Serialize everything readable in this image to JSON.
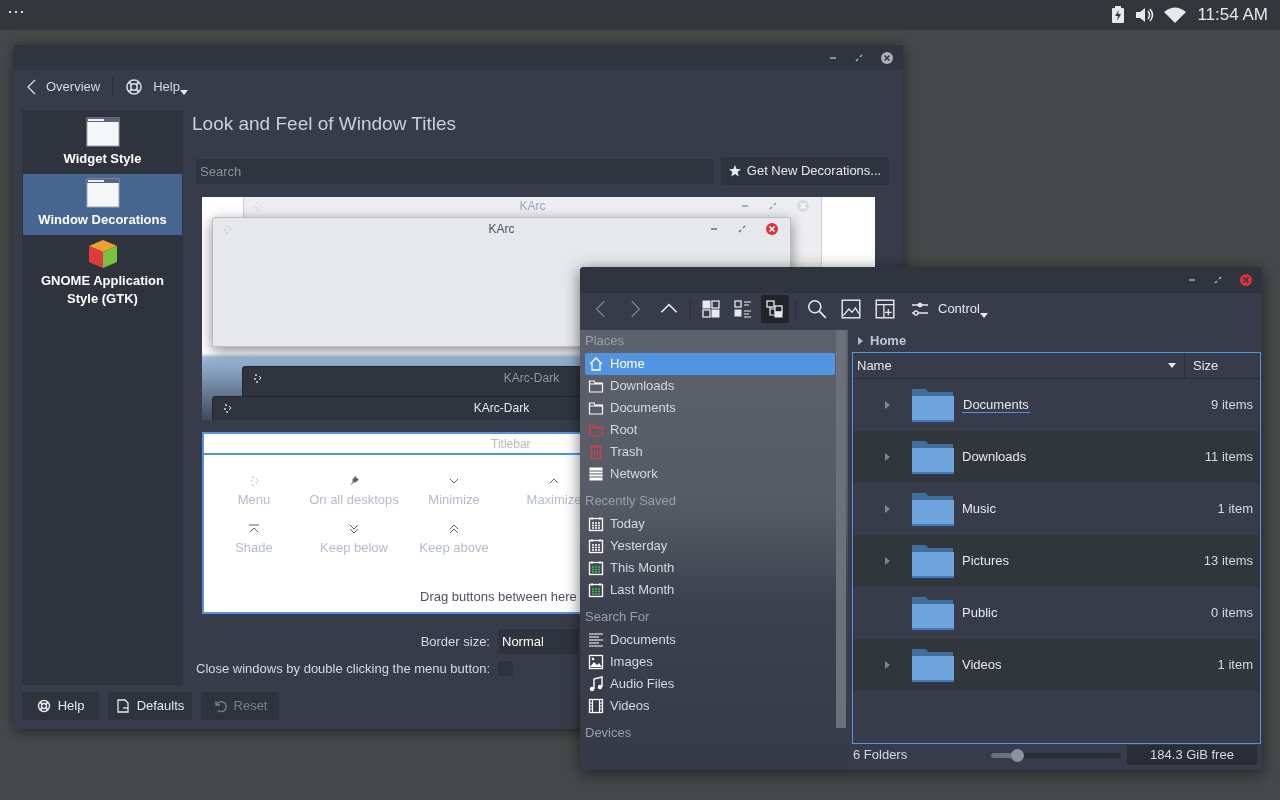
{
  "panel": {
    "menu": "⋯",
    "clock": "11:54 AM"
  },
  "settings": {
    "toolbar": {
      "back": "Overview",
      "help": "Help"
    },
    "sidebar": [
      {
        "label": "Widget Style",
        "kind": "window",
        "selected": false
      },
      {
        "label": "Window Decorations",
        "kind": "window",
        "selected": true
      },
      {
        "label": "GNOME Application Style (GTK)",
        "kind": "gtk",
        "selected": false
      }
    ],
    "heading": "Look and Feel of Window Titles",
    "search": {
      "placeholder": "Search"
    },
    "get_new": "Get New Decorations...",
    "previews": [
      {
        "title": "KArc",
        "kind": "light"
      },
      {
        "title": "KArc",
        "kind": "light"
      },
      {
        "title": "KArc-Dark",
        "kind": "dark"
      },
      {
        "title": "KArc-Dark",
        "kind": "dark"
      }
    ],
    "titlebar_editor": {
      "title": "Titlebar",
      "buttons": [
        {
          "label": "Menu",
          "kind": "menu"
        },
        {
          "label": "On all desktops",
          "kind": "pin"
        },
        {
          "label": "Minimize",
          "kind": "minimize"
        },
        {
          "label": "Maximize",
          "kind": "maximize"
        },
        {
          "label": "Shade",
          "kind": "shade"
        },
        {
          "label": "Keep below",
          "kind": "below"
        },
        {
          "label": "Keep above",
          "kind": "above"
        }
      ],
      "hint": "Drag buttons between here"
    },
    "border_size": {
      "label": "Border size:",
      "value": "Normal"
    },
    "close_on_double_click": {
      "label": "Close windows by double clicking the menu button:",
      "checked": false
    },
    "buttons": [
      {
        "label": "Help",
        "kind": "help",
        "disabled": false
      },
      {
        "label": "Defaults",
        "kind": "defaults",
        "disabled": false
      },
      {
        "label": "Reset",
        "kind": "reset",
        "disabled": true
      }
    ]
  },
  "file_manager": {
    "toolbar": {
      "view_modes": [
        {
          "kind": "icons",
          "selected": false
        },
        {
          "kind": "details",
          "selected": false
        },
        {
          "kind": "tree",
          "selected": true
        }
      ],
      "control": "Control"
    },
    "places": [
      {
        "heading": "Places",
        "items": [
          {
            "label": "Home",
            "kind": "home",
            "selected": true
          },
          {
            "label": "Downloads",
            "kind": "folder",
            "selected": false
          },
          {
            "label": "Documents",
            "kind": "folder",
            "selected": false
          },
          {
            "label": "Root",
            "kind": "root",
            "selected": false
          },
          {
            "label": "Trash",
            "kind": "trash",
            "selected": false
          },
          {
            "label": "Network",
            "kind": "network",
            "selected": false
          }
        ]
      },
      {
        "heading": "Recently Saved",
        "items": [
          {
            "label": "Today",
            "kind": "calendar",
            "selected": false
          },
          {
            "label": "Yesterday",
            "kind": "calendar",
            "selected": false
          },
          {
            "label": "This Month",
            "kind": "month",
            "selected": false
          },
          {
            "label": "Last Month",
            "kind": "month",
            "selected": false
          }
        ]
      },
      {
        "heading": "Search For",
        "items": [
          {
            "label": "Documents",
            "kind": "text",
            "selected": false
          },
          {
            "label": "Images",
            "kind": "image",
            "selected": false
          },
          {
            "label": "Audio Files",
            "kind": "audio",
            "selected": false
          },
          {
            "label": "Videos",
            "kind": "video",
            "selected": false
          }
        ]
      },
      {
        "heading": "Devices"
      }
    ],
    "breadcrumb": "Home",
    "columns": [
      "Name",
      "Size"
    ],
    "rows": [
      {
        "name": "Documents",
        "size": "9 items",
        "expandable": true,
        "hovered": true
      },
      {
        "name": "Downloads",
        "size": "11 items",
        "expandable": true,
        "hovered": false
      },
      {
        "name": "Music",
        "size": "1 item",
        "expandable": true,
        "hovered": false
      },
      {
        "name": "Pictures",
        "size": "13 items",
        "expandable": true,
        "hovered": false
      },
      {
        "name": "Public",
        "size": "0 items",
        "expandable": false,
        "hovered": false
      },
      {
        "name": "Videos",
        "size": "1 item",
        "expandable": true,
        "hovered": false
      }
    ],
    "status": {
      "count": "6 Folders",
      "zoom": {
        "level": 0.2
      },
      "free": "184.3 GiB free"
    }
  }
}
